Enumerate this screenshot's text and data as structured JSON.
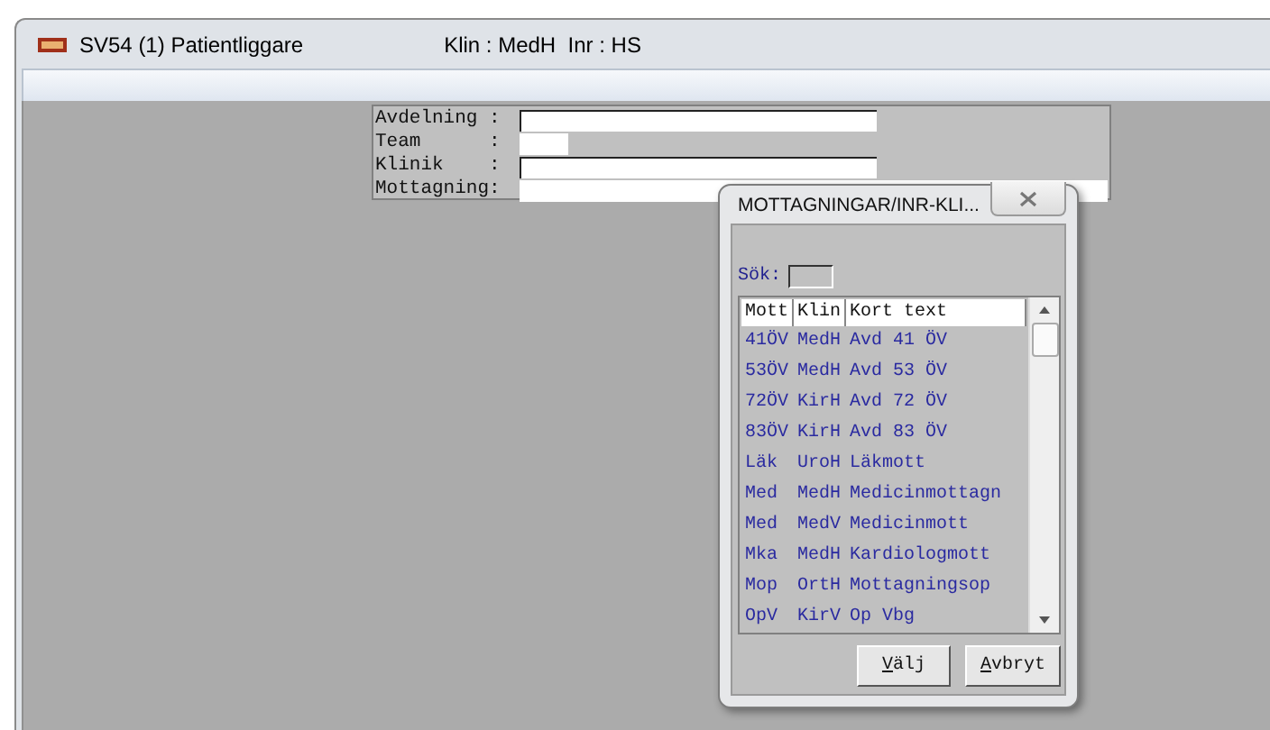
{
  "window": {
    "title": "SV54 (1) Patientliggare",
    "context": "Klin : MedH  Inr : HS"
  },
  "form": {
    "fields": [
      {
        "label": "Avdelning :",
        "kind": "long"
      },
      {
        "label": "Team      :",
        "kind": "short"
      },
      {
        "label": "Klinik    :",
        "kind": "long"
      },
      {
        "label": "Mottagning:",
        "kind": "wide"
      }
    ]
  },
  "dialog": {
    "title": "MOTTAGNINGAR/INR-KLI...",
    "search_label": "Sök:",
    "columns": [
      "Mott",
      "Klin",
      "Kort text"
    ],
    "rows": [
      [
        "41ÖV",
        "MedH",
        "Avd 41 ÖV"
      ],
      [
        "53ÖV",
        "MedH",
        "Avd 53 ÖV"
      ],
      [
        "72ÖV",
        "KirH",
        "Avd 72 ÖV"
      ],
      [
        "83ÖV",
        "KirH",
        "Avd 83 ÖV"
      ],
      [
        "Läk",
        "UroH",
        "Läkmott"
      ],
      [
        "Med",
        "MedH",
        "Medicinmottagn"
      ],
      [
        "Med",
        "MedV",
        "Medicinmott"
      ],
      [
        "Mka",
        "MedH",
        "Kardiologmott"
      ],
      [
        "Mop",
        "OrtH",
        "Mottagningsop"
      ],
      [
        "OpV",
        "KirV",
        "Op Vbg"
      ]
    ],
    "buttons": [
      "Välj",
      "Avbryt"
    ]
  }
}
